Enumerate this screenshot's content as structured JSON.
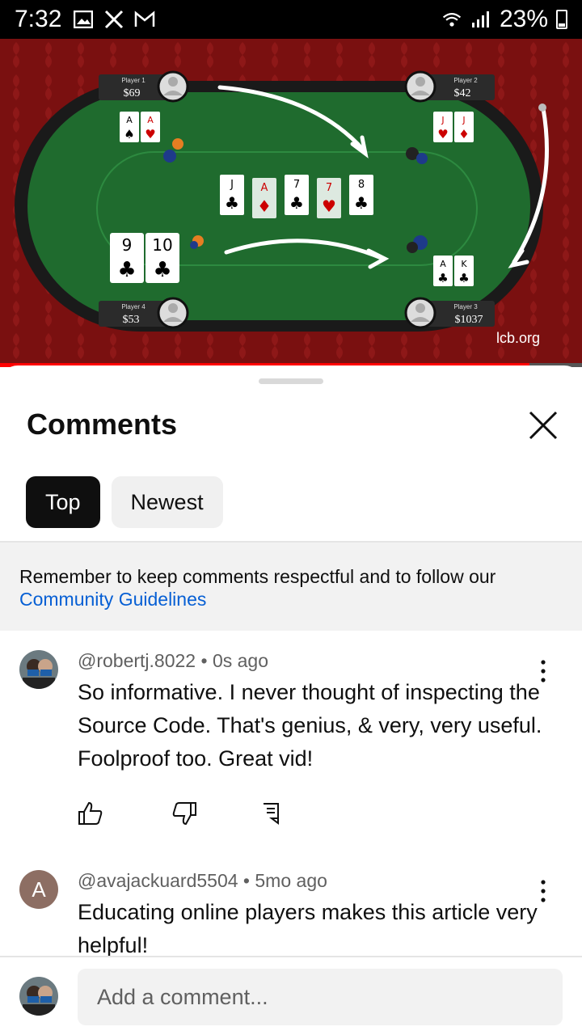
{
  "status_bar": {
    "time": "7:32",
    "battery": "23%",
    "icons_left": [
      "gallery-icon",
      "x-icon",
      "gmail-icon"
    ],
    "icons_right": [
      "wifi-icon",
      "signal-icon"
    ]
  },
  "video": {
    "watermark": "lcb.org",
    "progress": 0.91,
    "players": [
      {
        "name": "Player 1",
        "stack": "$69"
      },
      {
        "name": "Player 2",
        "stack": "$42"
      },
      {
        "name": "Player 4",
        "stack": "$53"
      },
      {
        "name": "Player 3",
        "stack": "$1037"
      }
    ],
    "cards": {
      "p1": [
        "A♠",
        "A♥"
      ],
      "p2": [
        "J♥",
        "J♦"
      ],
      "p4": [
        "9♣",
        "10♣"
      ],
      "p3": [
        "A♣",
        "K♣"
      ],
      "board": [
        "J♣",
        "A♦",
        "7♣",
        "7♥",
        "8♣"
      ]
    },
    "colors": {
      "felt": "#1f6b2e",
      "backdrop": "#7a1010",
      "rail": "#1a1a1a"
    }
  },
  "comments_panel": {
    "title": "Comments",
    "tabs": [
      {
        "label": "Top",
        "active": true
      },
      {
        "label": "Newest",
        "active": false
      }
    ],
    "notice_text": "Remember to keep comments respectful and to follow our",
    "notice_link": "Community Guidelines",
    "comments": [
      {
        "author": "@robertj.8022",
        "age": "0s ago",
        "text": "So informative.  I never thought of inspecting the Source Code.  That's genius, & very, very useful.  Foolproof too.  Great vid!"
      },
      {
        "author": "@avajackuard5504",
        "age": "5mo ago",
        "avatar_letter": "A",
        "text": "Educating online players makes this article very helpful!"
      }
    ],
    "add_comment_placeholder": "Add a comment...",
    "meta_separator": " • "
  }
}
